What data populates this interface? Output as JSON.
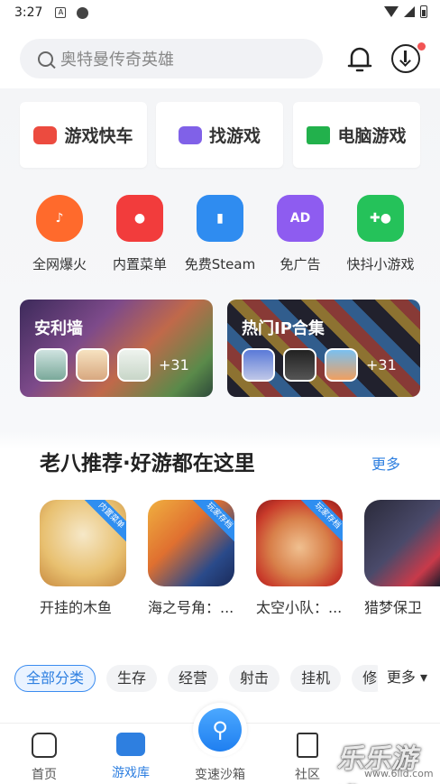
{
  "status": {
    "time": "3:27",
    "a_icon": "A"
  },
  "search": {
    "placeholder": "奥特曼传奇英雄"
  },
  "banners": [
    {
      "label": "游戏快车",
      "icon": "car-icon"
    },
    {
      "label": "找游戏",
      "icon": "gamepad-icon"
    },
    {
      "label": "电脑游戏",
      "icon": "pc-icon"
    }
  ],
  "categories": [
    {
      "label": "全网爆火",
      "icon": "flame-icon",
      "color": "#ff6a2c"
    },
    {
      "label": "内置菜单",
      "icon": "menu-icon",
      "color": "#f23c3c"
    },
    {
      "label": "免费Steam",
      "icon": "steam-icon",
      "color": "#2f8cf0"
    },
    {
      "label": "免广告",
      "icon": "ad-icon",
      "color": "#8e5cf0"
    },
    {
      "label": "快抖小游戏",
      "icon": "controller-icon",
      "color": "#25c25a"
    }
  ],
  "promos": [
    {
      "title": "安利墙",
      "count": "+31"
    },
    {
      "title": "热门IP合集",
      "count": "+31"
    }
  ],
  "recommend": {
    "title": "老八推荐·好游都在这里",
    "more": "更多",
    "games": [
      {
        "name": "开挂的木鱼",
        "tag": "内置菜单"
      },
      {
        "name": "海之号角：...",
        "tag": "玩家存档"
      },
      {
        "name": "太空小队：...",
        "tag": "玩家存档"
      },
      {
        "name": "猎梦保卫",
        "tag": ""
      }
    ]
  },
  "chips": [
    "全部分类",
    "生存",
    "经营",
    "射击",
    "挂机",
    "修"
  ],
  "chips_more": "更多 ▾",
  "tabs": {
    "home": "首页",
    "library": "游戏库",
    "sandbox": "变速沙箱",
    "community": "社区"
  },
  "watermark": {
    "text": "乐乐游戏",
    "url": "www.6lld.com"
  }
}
